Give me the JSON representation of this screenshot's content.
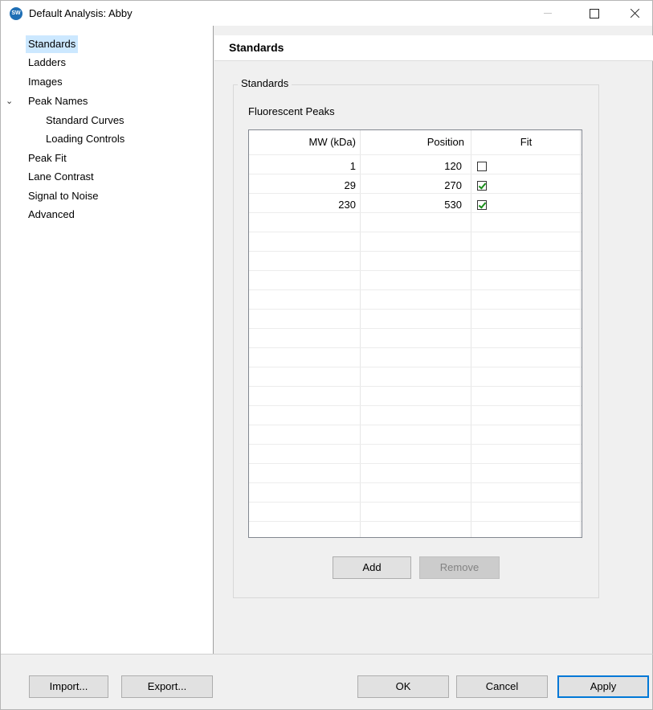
{
  "window": {
    "title": "Default Analysis: Abby",
    "app_icon": "SW"
  },
  "tree": {
    "items": [
      {
        "label": "Standards",
        "selected": true
      },
      {
        "label": "Ladders"
      },
      {
        "label": "Images"
      },
      {
        "label": "Peak Names",
        "expanded": true
      },
      {
        "label": "Standard Curves"
      },
      {
        "label": "Loading Controls"
      },
      {
        "label": "Peak Fit"
      },
      {
        "label": "Lane Contrast"
      },
      {
        "label": "Signal to Noise"
      },
      {
        "label": "Advanced"
      }
    ]
  },
  "main": {
    "header": "Standards",
    "group_title": "Standards",
    "section_label": "Fluorescent Peaks",
    "table": {
      "columns": [
        "MW (kDa)",
        "Position",
        "Fit"
      ],
      "rows": [
        {
          "mw": "1",
          "position": "120",
          "fit": false
        },
        {
          "mw": "29",
          "position": "270",
          "fit": true
        },
        {
          "mw": "230",
          "position": "530",
          "fit": true
        }
      ]
    },
    "buttons": {
      "add": "Add",
      "remove": "Remove"
    }
  },
  "footer": {
    "import": "Import...",
    "export": "Export...",
    "ok": "OK",
    "cancel": "Cancel",
    "apply": "Apply"
  },
  "colors": {
    "selection": "#cce8ff",
    "check": "#1a8f1a",
    "default_button_border": "#0078d7"
  }
}
